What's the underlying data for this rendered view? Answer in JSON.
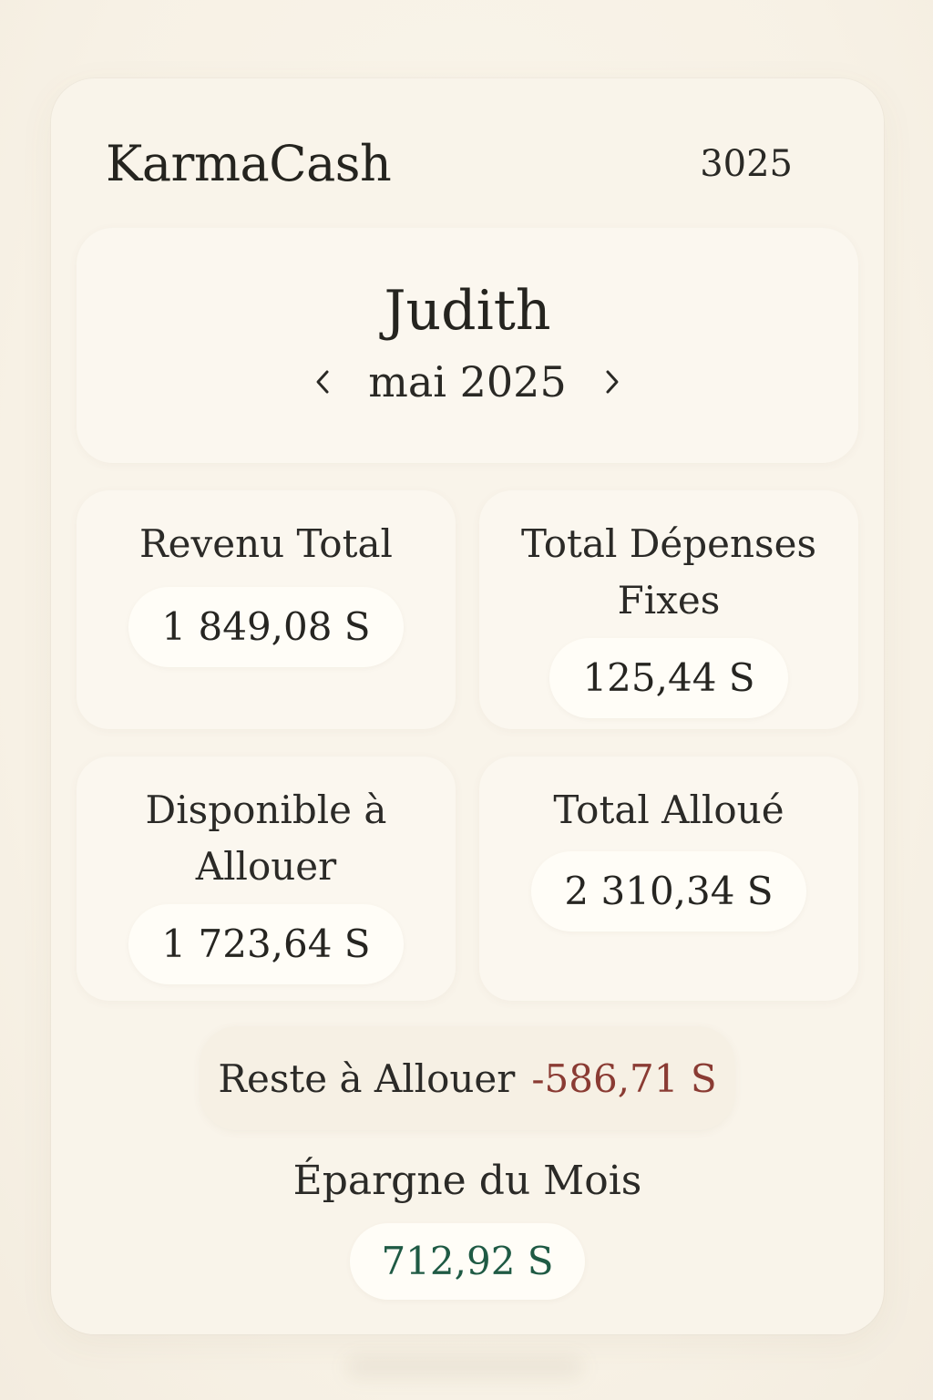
{
  "header": {
    "app_title": "KarmaCash",
    "year": "3025"
  },
  "profile": {
    "name": "Judith",
    "month": "mai 2025"
  },
  "stats": {
    "revenu": {
      "label": "Revenu Total",
      "value": "1 849,08 S"
    },
    "depenses": {
      "label_line1": "Total Dépenses",
      "label_line2": "Fixes",
      "value": "125,44 S"
    },
    "disponible": {
      "label_line1": "Disponible à",
      "label_line2": "Allouer",
      "value": "1 723,64 S"
    },
    "alloue": {
      "label": "Total Alloué",
      "value": "2 310,34 S"
    }
  },
  "reste": {
    "label": "Reste à Allouer",
    "value": "-586,71 S"
  },
  "epargne": {
    "label": "Épargne du Mois",
    "value": "712,92 S"
  },
  "icons": {
    "prev": "chevron-left-icon",
    "next": "chevron-right-icon"
  },
  "colors": {
    "background": "#f7f1e5",
    "negative": "#8a3b33",
    "positive": "#1f5a44"
  }
}
